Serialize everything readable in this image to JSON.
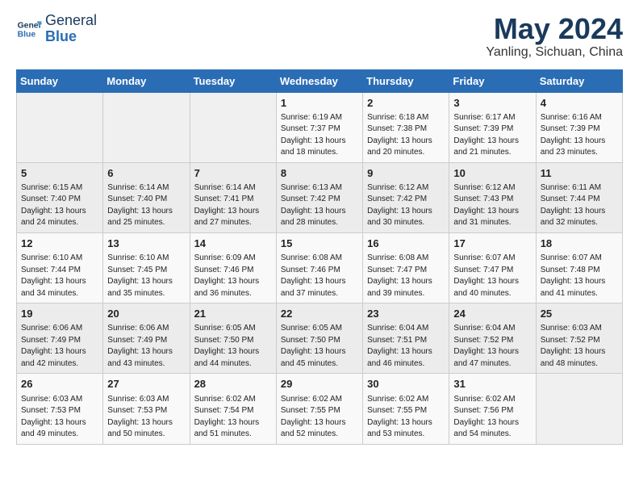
{
  "header": {
    "logo_line1": "General",
    "logo_line2": "Blue",
    "title": "May 2024",
    "subtitle": "Yanling, Sichuan, China"
  },
  "weekdays": [
    "Sunday",
    "Monday",
    "Tuesday",
    "Wednesday",
    "Thursday",
    "Friday",
    "Saturday"
  ],
  "weeks": [
    [
      {
        "day": "",
        "info": ""
      },
      {
        "day": "",
        "info": ""
      },
      {
        "day": "",
        "info": ""
      },
      {
        "day": "1",
        "info": "Sunrise: 6:19 AM\nSunset: 7:37 PM\nDaylight: 13 hours and 18 minutes."
      },
      {
        "day": "2",
        "info": "Sunrise: 6:18 AM\nSunset: 7:38 PM\nDaylight: 13 hours and 20 minutes."
      },
      {
        "day": "3",
        "info": "Sunrise: 6:17 AM\nSunset: 7:39 PM\nDaylight: 13 hours and 21 minutes."
      },
      {
        "day": "4",
        "info": "Sunrise: 6:16 AM\nSunset: 7:39 PM\nDaylight: 13 hours and 23 minutes."
      }
    ],
    [
      {
        "day": "5",
        "info": "Sunrise: 6:15 AM\nSunset: 7:40 PM\nDaylight: 13 hours and 24 minutes."
      },
      {
        "day": "6",
        "info": "Sunrise: 6:14 AM\nSunset: 7:40 PM\nDaylight: 13 hours and 25 minutes."
      },
      {
        "day": "7",
        "info": "Sunrise: 6:14 AM\nSunset: 7:41 PM\nDaylight: 13 hours and 27 minutes."
      },
      {
        "day": "8",
        "info": "Sunrise: 6:13 AM\nSunset: 7:42 PM\nDaylight: 13 hours and 28 minutes."
      },
      {
        "day": "9",
        "info": "Sunrise: 6:12 AM\nSunset: 7:42 PM\nDaylight: 13 hours and 30 minutes."
      },
      {
        "day": "10",
        "info": "Sunrise: 6:12 AM\nSunset: 7:43 PM\nDaylight: 13 hours and 31 minutes."
      },
      {
        "day": "11",
        "info": "Sunrise: 6:11 AM\nSunset: 7:44 PM\nDaylight: 13 hours and 32 minutes."
      }
    ],
    [
      {
        "day": "12",
        "info": "Sunrise: 6:10 AM\nSunset: 7:44 PM\nDaylight: 13 hours and 34 minutes."
      },
      {
        "day": "13",
        "info": "Sunrise: 6:10 AM\nSunset: 7:45 PM\nDaylight: 13 hours and 35 minutes."
      },
      {
        "day": "14",
        "info": "Sunrise: 6:09 AM\nSunset: 7:46 PM\nDaylight: 13 hours and 36 minutes."
      },
      {
        "day": "15",
        "info": "Sunrise: 6:08 AM\nSunset: 7:46 PM\nDaylight: 13 hours and 37 minutes."
      },
      {
        "day": "16",
        "info": "Sunrise: 6:08 AM\nSunset: 7:47 PM\nDaylight: 13 hours and 39 minutes."
      },
      {
        "day": "17",
        "info": "Sunrise: 6:07 AM\nSunset: 7:47 PM\nDaylight: 13 hours and 40 minutes."
      },
      {
        "day": "18",
        "info": "Sunrise: 6:07 AM\nSunset: 7:48 PM\nDaylight: 13 hours and 41 minutes."
      }
    ],
    [
      {
        "day": "19",
        "info": "Sunrise: 6:06 AM\nSunset: 7:49 PM\nDaylight: 13 hours and 42 minutes."
      },
      {
        "day": "20",
        "info": "Sunrise: 6:06 AM\nSunset: 7:49 PM\nDaylight: 13 hours and 43 minutes."
      },
      {
        "day": "21",
        "info": "Sunrise: 6:05 AM\nSunset: 7:50 PM\nDaylight: 13 hours and 44 minutes."
      },
      {
        "day": "22",
        "info": "Sunrise: 6:05 AM\nSunset: 7:50 PM\nDaylight: 13 hours and 45 minutes."
      },
      {
        "day": "23",
        "info": "Sunrise: 6:04 AM\nSunset: 7:51 PM\nDaylight: 13 hours and 46 minutes."
      },
      {
        "day": "24",
        "info": "Sunrise: 6:04 AM\nSunset: 7:52 PM\nDaylight: 13 hours and 47 minutes."
      },
      {
        "day": "25",
        "info": "Sunrise: 6:03 AM\nSunset: 7:52 PM\nDaylight: 13 hours and 48 minutes."
      }
    ],
    [
      {
        "day": "26",
        "info": "Sunrise: 6:03 AM\nSunset: 7:53 PM\nDaylight: 13 hours and 49 minutes."
      },
      {
        "day": "27",
        "info": "Sunrise: 6:03 AM\nSunset: 7:53 PM\nDaylight: 13 hours and 50 minutes."
      },
      {
        "day": "28",
        "info": "Sunrise: 6:02 AM\nSunset: 7:54 PM\nDaylight: 13 hours and 51 minutes."
      },
      {
        "day": "29",
        "info": "Sunrise: 6:02 AM\nSunset: 7:55 PM\nDaylight: 13 hours and 52 minutes."
      },
      {
        "day": "30",
        "info": "Sunrise: 6:02 AM\nSunset: 7:55 PM\nDaylight: 13 hours and 53 minutes."
      },
      {
        "day": "31",
        "info": "Sunrise: 6:02 AM\nSunset: 7:56 PM\nDaylight: 13 hours and 54 minutes."
      },
      {
        "day": "",
        "info": ""
      }
    ]
  ]
}
